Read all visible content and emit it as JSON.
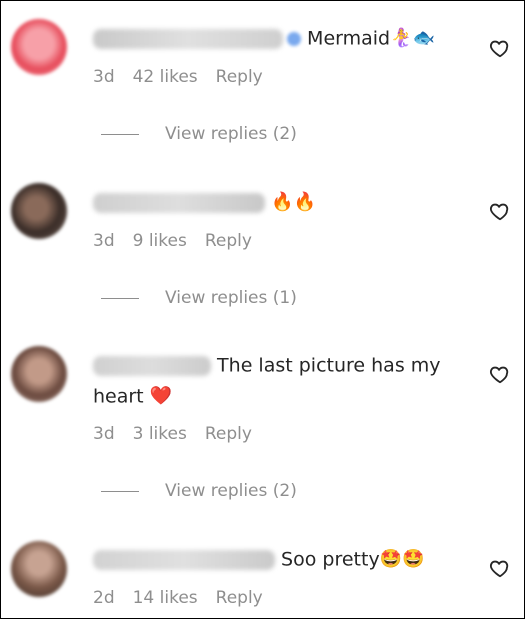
{
  "comments": [
    {
      "text": "Mermaid",
      "emoji": "🧜‍♀️🐟",
      "time": "3d",
      "likes": "42 likes",
      "reply": "Reply",
      "replies": "View replies (2)"
    },
    {
      "text": "",
      "emoji": "🔥🔥",
      "time": "3d",
      "likes": "9 likes",
      "reply": "Reply",
      "replies": "View replies (1)"
    },
    {
      "text": "The last picture has my",
      "text2": "heart",
      "emoji": "❤️",
      "time": "3d",
      "likes": "3 likes",
      "reply": "Reply",
      "replies": "View replies (2)"
    },
    {
      "text": "Soo pretty",
      "emoji": "🤩🤩",
      "time": "2d",
      "likes": "14 likes",
      "reply": "Reply"
    }
  ],
  "icons": {
    "like": "heart-outline-icon"
  },
  "colors": {
    "text": "#262626",
    "meta": "#8e8e8e"
  }
}
